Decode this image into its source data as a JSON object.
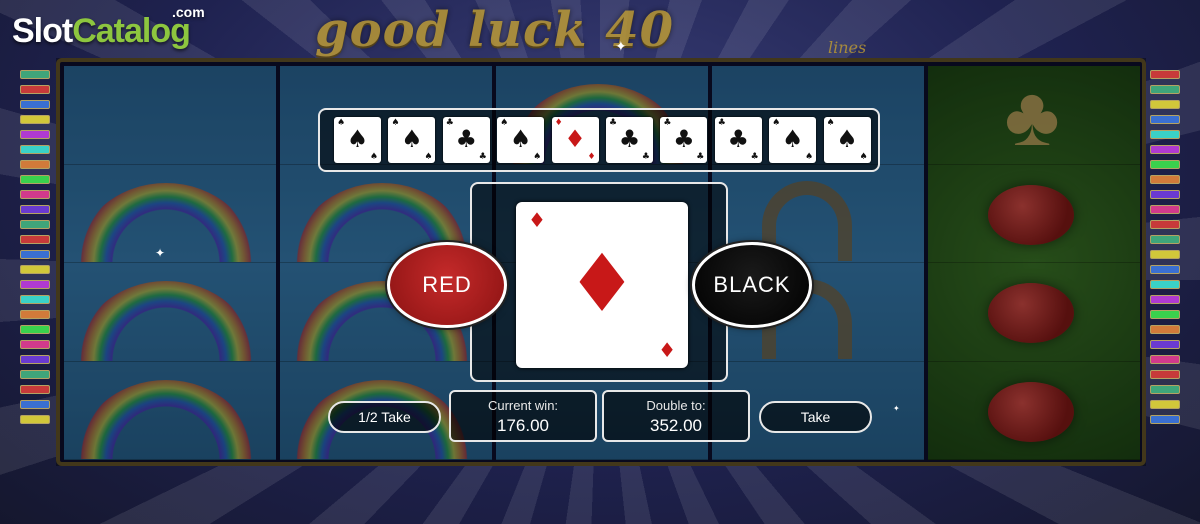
{
  "watermark": {
    "brand_a": "Slot",
    "brand_b": "Catalog",
    "suffix": ".com"
  },
  "game_title": {
    "main": "good luck 40",
    "sub": "lines"
  },
  "history_cards": [
    {
      "suit": "♠",
      "color": "black"
    },
    {
      "suit": "♠",
      "color": "black"
    },
    {
      "suit": "♣",
      "color": "black"
    },
    {
      "suit": "♠",
      "color": "black"
    },
    {
      "suit": "♦",
      "color": "red"
    },
    {
      "suit": "♣",
      "color": "black"
    },
    {
      "suit": "♣",
      "color": "black"
    },
    {
      "suit": "♣",
      "color": "black"
    },
    {
      "suit": "♠",
      "color": "black"
    },
    {
      "suit": "♠",
      "color": "black"
    }
  ],
  "current_card": {
    "suit": "♦",
    "color": "red",
    "state": "face up"
  },
  "gamble": {
    "red_label": "RED",
    "black_label": "BLACK",
    "half_take_label": "1/2 Take",
    "take_label": "Take",
    "current_win_label": "Current win:",
    "current_win_value": "176.00",
    "double_to_label": "Double to:",
    "double_to_value": "352.00"
  },
  "icons": {
    "clover": "clover-icon",
    "ladybug": "ladybug-icon",
    "rainbow": "rainbow-icon",
    "horseshoe": "horseshoe-icon"
  },
  "colors": {
    "red_button": "#a81c1c",
    "black_button": "#000000",
    "frame": "#6b5a2a",
    "brand_green": "#8dc63f"
  }
}
